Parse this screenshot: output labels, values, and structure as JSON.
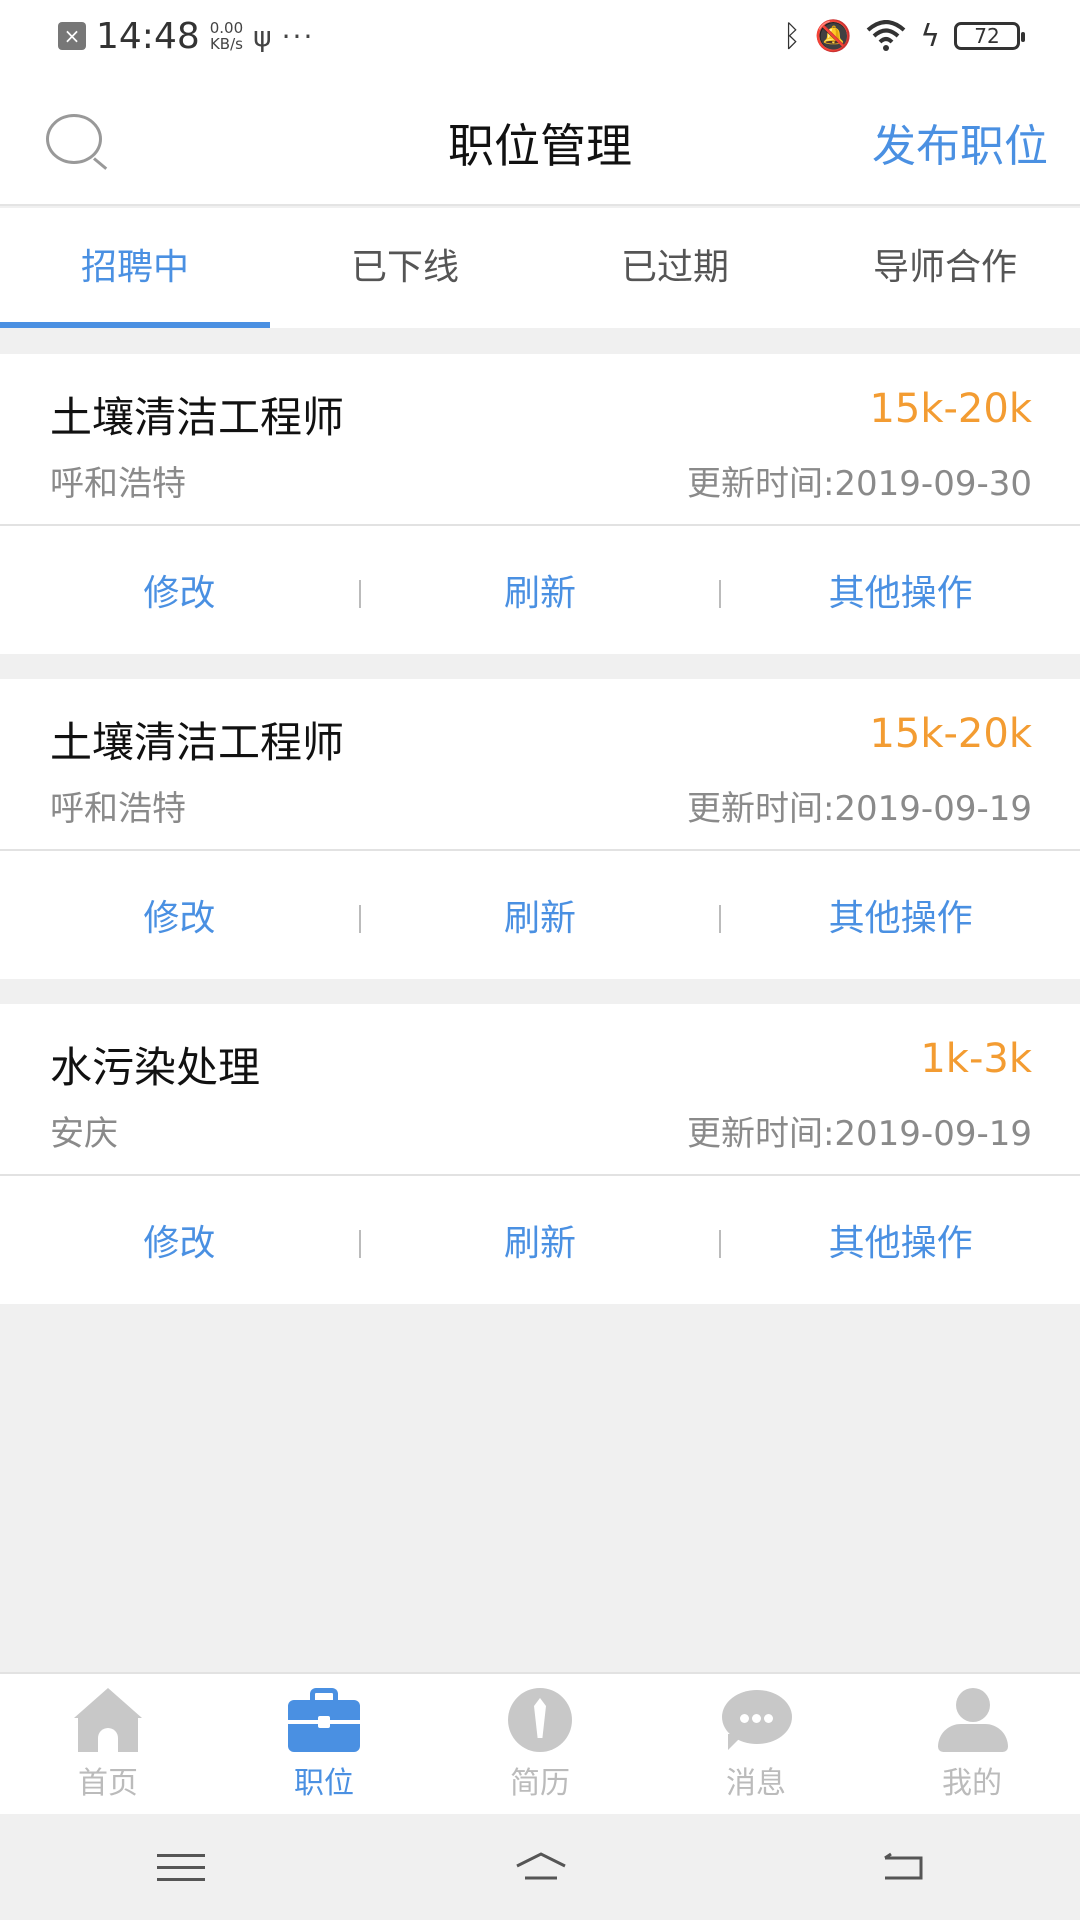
{
  "status_bar": {
    "time": "14:48",
    "speed_value": "0.00",
    "speed_unit": "KB/s",
    "battery": "72"
  },
  "header": {
    "title": "职位管理",
    "publish_label": "发布职位"
  },
  "tabs": [
    {
      "label": "招聘中",
      "active": true
    },
    {
      "label": "已下线"
    },
    {
      "label": "已过期"
    },
    {
      "label": "导师合作"
    }
  ],
  "jobs": [
    {
      "title": "土壤清洁工程师",
      "salary": "15k-20k",
      "location": "呼和浩特",
      "updated": "更新时间:2019-09-30",
      "actions": {
        "edit": "修改",
        "refresh": "刷新",
        "more": "其他操作"
      }
    },
    {
      "title": "土壤清洁工程师",
      "salary": "15k-20k",
      "location": "呼和浩特",
      "updated": "更新时间:2019-09-19",
      "actions": {
        "edit": "修改",
        "refresh": "刷新",
        "more": "其他操作"
      }
    },
    {
      "title": "水污染处理",
      "salary": "1k-3k",
      "location": "安庆",
      "updated": "更新时间:2019-09-19",
      "actions": {
        "edit": "修改",
        "refresh": "刷新",
        "more": "其他操作"
      }
    }
  ],
  "bottom_nav": [
    {
      "label": "首页",
      "icon": "home-icon"
    },
    {
      "label": "职位",
      "icon": "briefcase-icon",
      "active": true
    },
    {
      "label": "简历",
      "icon": "resume-icon"
    },
    {
      "label": "消息",
      "icon": "message-icon"
    },
    {
      "label": "我的",
      "icon": "profile-icon"
    }
  ],
  "colors": {
    "accent": "#4a90e2",
    "salary": "#f39c32",
    "muted_text": "#8a8a8a",
    "background": "#f0f0f0"
  }
}
